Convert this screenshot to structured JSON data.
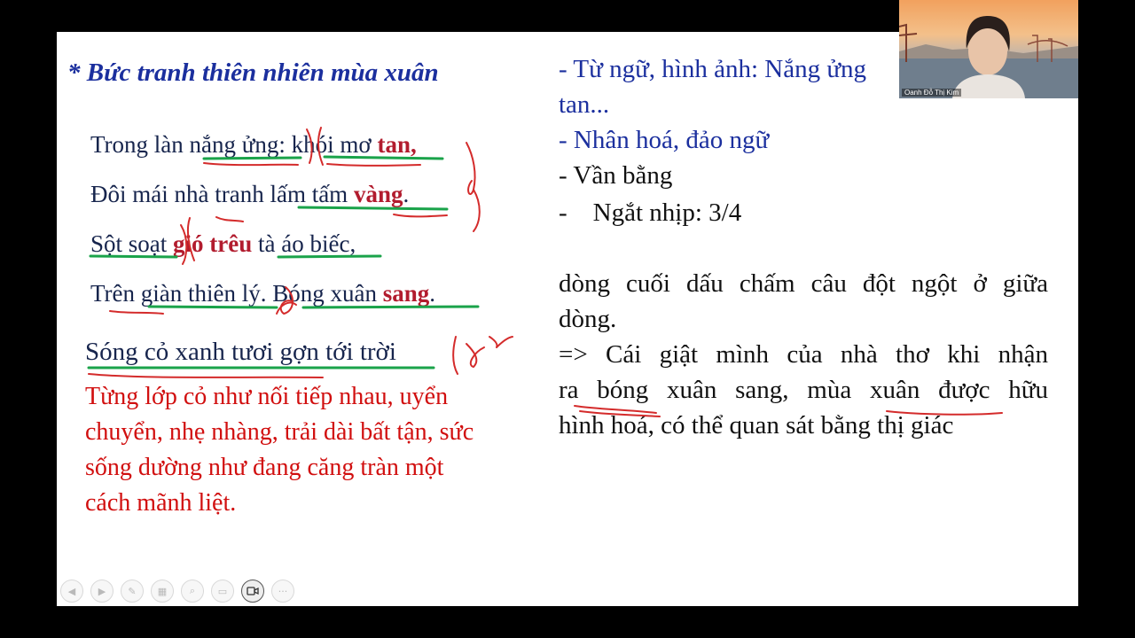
{
  "slide": {
    "title": "* Bức tranh thiên nhiên mùa xuân",
    "poem": {
      "line1": {
        "a": "Trong làn ",
        "b": "nắng ửng",
        "c": ": ",
        "d": "khói mơ ",
        "e": "tan,"
      },
      "line2": {
        "a": "Đôi mái nhà tranh ",
        "b": "lấm tấm ",
        "c": "vàng",
        "d": "."
      },
      "line3": {
        "a": "Sột soạt ",
        "b": "gió trêu",
        "c": " tà áo biếc,"
      },
      "line4": {
        "a": "Trên ",
        "b": "giàn thiên lý",
        "c": ". Bóng xuân ",
        "d": "sang",
        "e": "."
      }
    },
    "verse5": "Sóng cỏ xanh tươi gợn tới trời",
    "analysis_text": "Từng lớp cỏ như nối tiếp nhau, uyển chuyển, nhẹ nhàng, trải dài bất tận, sức sống dường như đang căng tràn một cách mãnh liệt.",
    "right": {
      "item1a": "- Từ ngữ, hình ảnh: Nắng ửng",
      "item1b": "tan...",
      "item2": "- Nhân hoá, đảo ngữ",
      "item3": "- Vần bằng",
      "item4": "-    Ngắt nhịp: 3/4",
      "p1_line1": "dòng cuối dấu chấm câu đột ngột ở giữa",
      "p1_line2": "dòng.",
      "p2_line1": "=> Cái giật mình của nhà thơ khi nhận",
      "p2_line2": "ra bóng xuân sang, mùa xuân được hữu",
      "p2_line3": "hình hoá, có thể quan sát bằng thị giác"
    }
  },
  "webcam": {
    "name": "Oanh Đỗ Thị Kim"
  },
  "toolbar": {
    "icons": [
      "prev-icon",
      "next-icon",
      "pen-icon",
      "slides-icon",
      "zoom-icon",
      "subtitle-icon",
      "camera-icon",
      "more-icon"
    ],
    "more_label": "···"
  },
  "colors": {
    "title_blue": "#1b2f9e",
    "emphasis_red": "#c42121",
    "ink_red": "#d42b2b",
    "highlight_green": "#1aa34a"
  }
}
